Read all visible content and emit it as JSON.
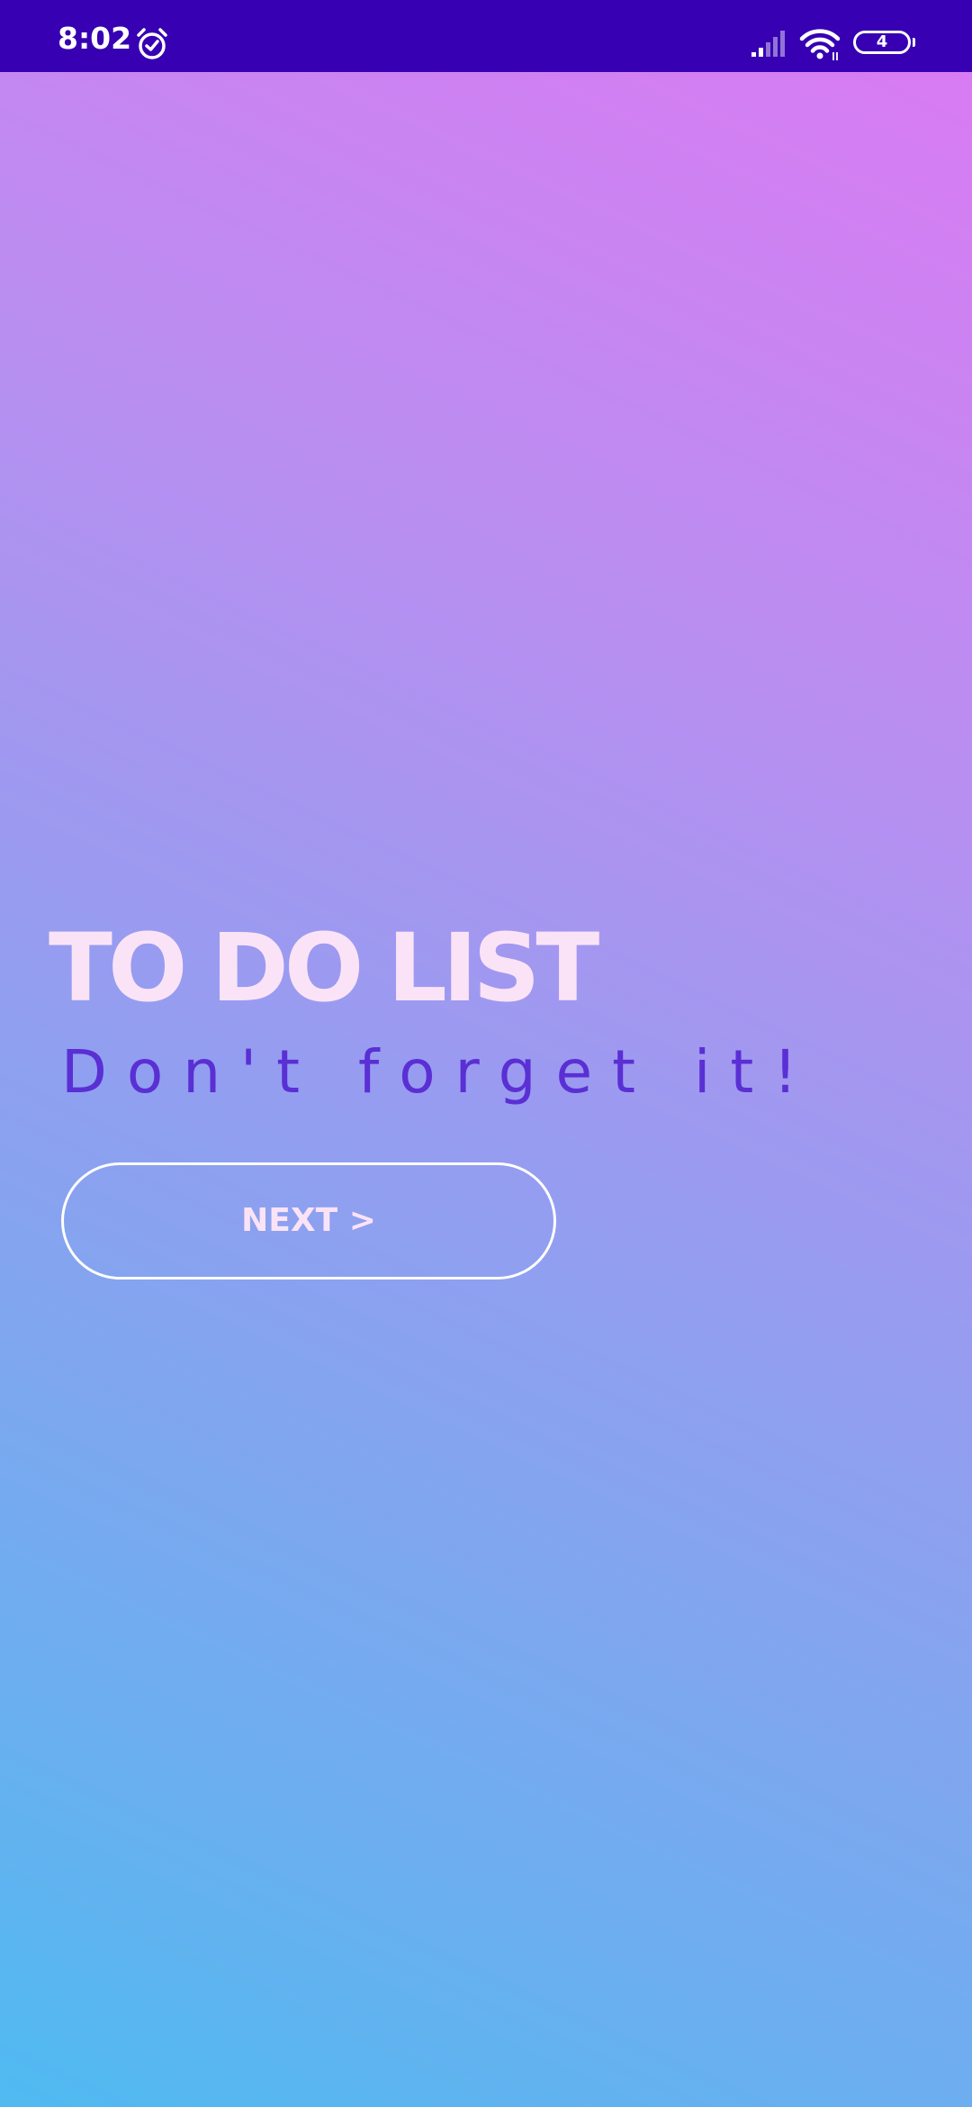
{
  "status_bar": {
    "time": "8:02",
    "battery_level": "4",
    "background_color": "#3700b3",
    "icons": [
      "alarm-icon",
      "signal-icon",
      "wifi-icon",
      "battery-icon"
    ]
  },
  "main": {
    "title": "TO DO LIST",
    "tagline": "Don't forget it!",
    "next_button_label": "NEXT >"
  },
  "colors": {
    "gradient_top_right": "#d97bf3",
    "gradient_bottom_left": "#4fbaf1",
    "title_color": "#fbe3f7",
    "tagline_color": "#5a2fd4",
    "button_border": "#ffffff"
  }
}
